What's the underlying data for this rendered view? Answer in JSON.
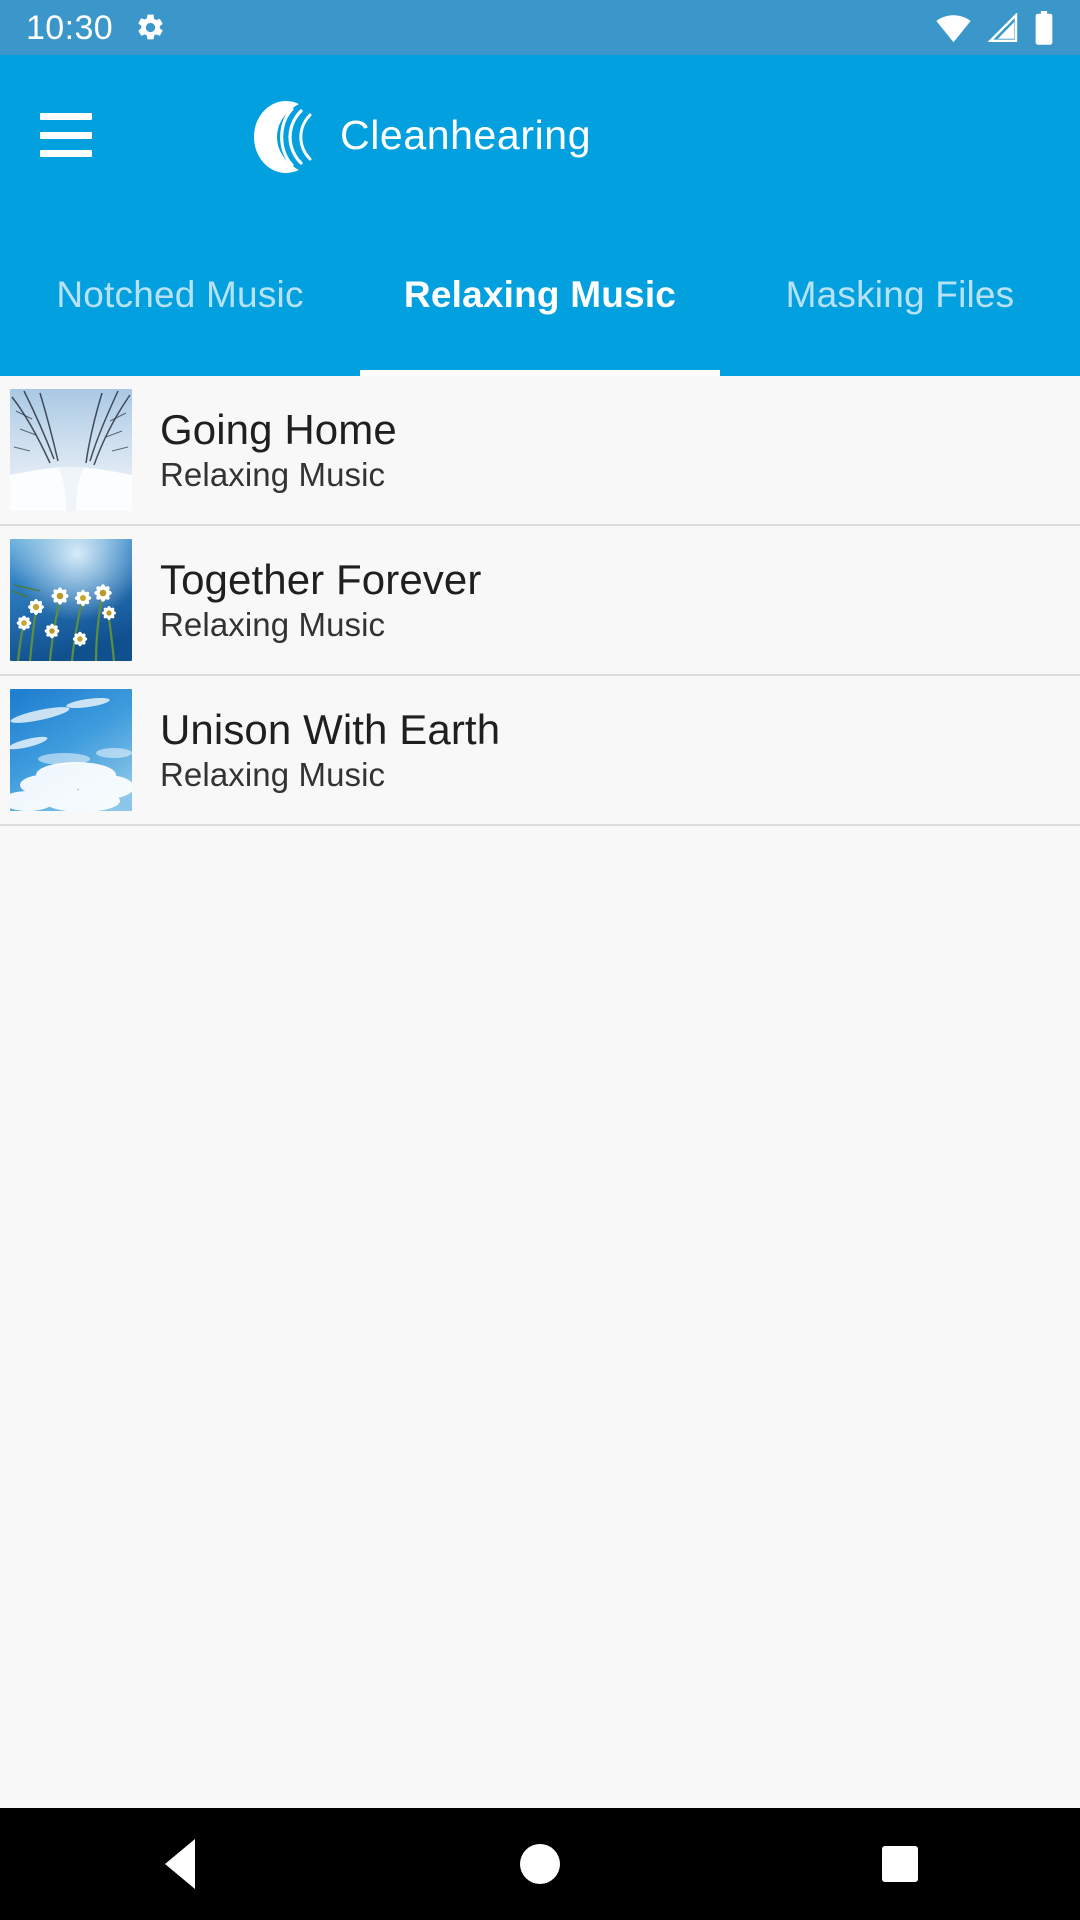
{
  "status_bar": {
    "time": "10:30",
    "gear_icon": "gear-icon",
    "wifi_icon": "wifi-full-icon",
    "signal_icon": "cellular-signal-icon",
    "battery_icon": "battery-full-icon",
    "background_color": "#3b97c9"
  },
  "app_bar": {
    "menu_icon": "hamburger-menu-icon",
    "logo_icon": "cleanhearing-logo-icon",
    "title": "Cleanhearing",
    "background_color": "#03a0e0"
  },
  "tabs": {
    "active_index": 1,
    "items": [
      {
        "label": "Notched Music",
        "active": false
      },
      {
        "label": "Relaxing Music",
        "active": true
      },
      {
        "label": "Masking Files",
        "active": false
      }
    ],
    "active_color": "#ffffff",
    "inactive_color": "#b7e2f6"
  },
  "list": {
    "items": [
      {
        "title": "Going Home",
        "subtitle": "Relaxing Music",
        "thumbnail": "snowy-forest-path-thumbnail"
      },
      {
        "title": "Together Forever",
        "subtitle": "Relaxing Music",
        "thumbnail": "daisies-blue-sky-thumbnail"
      },
      {
        "title": "Unison With Earth",
        "subtitle": "Relaxing Music",
        "thumbnail": "blue-sky-clouds-thumbnail"
      }
    ]
  },
  "nav_bar": {
    "back_label": "back-button",
    "home_label": "home-button",
    "recents_label": "recents-button",
    "background_color": "#000000"
  }
}
